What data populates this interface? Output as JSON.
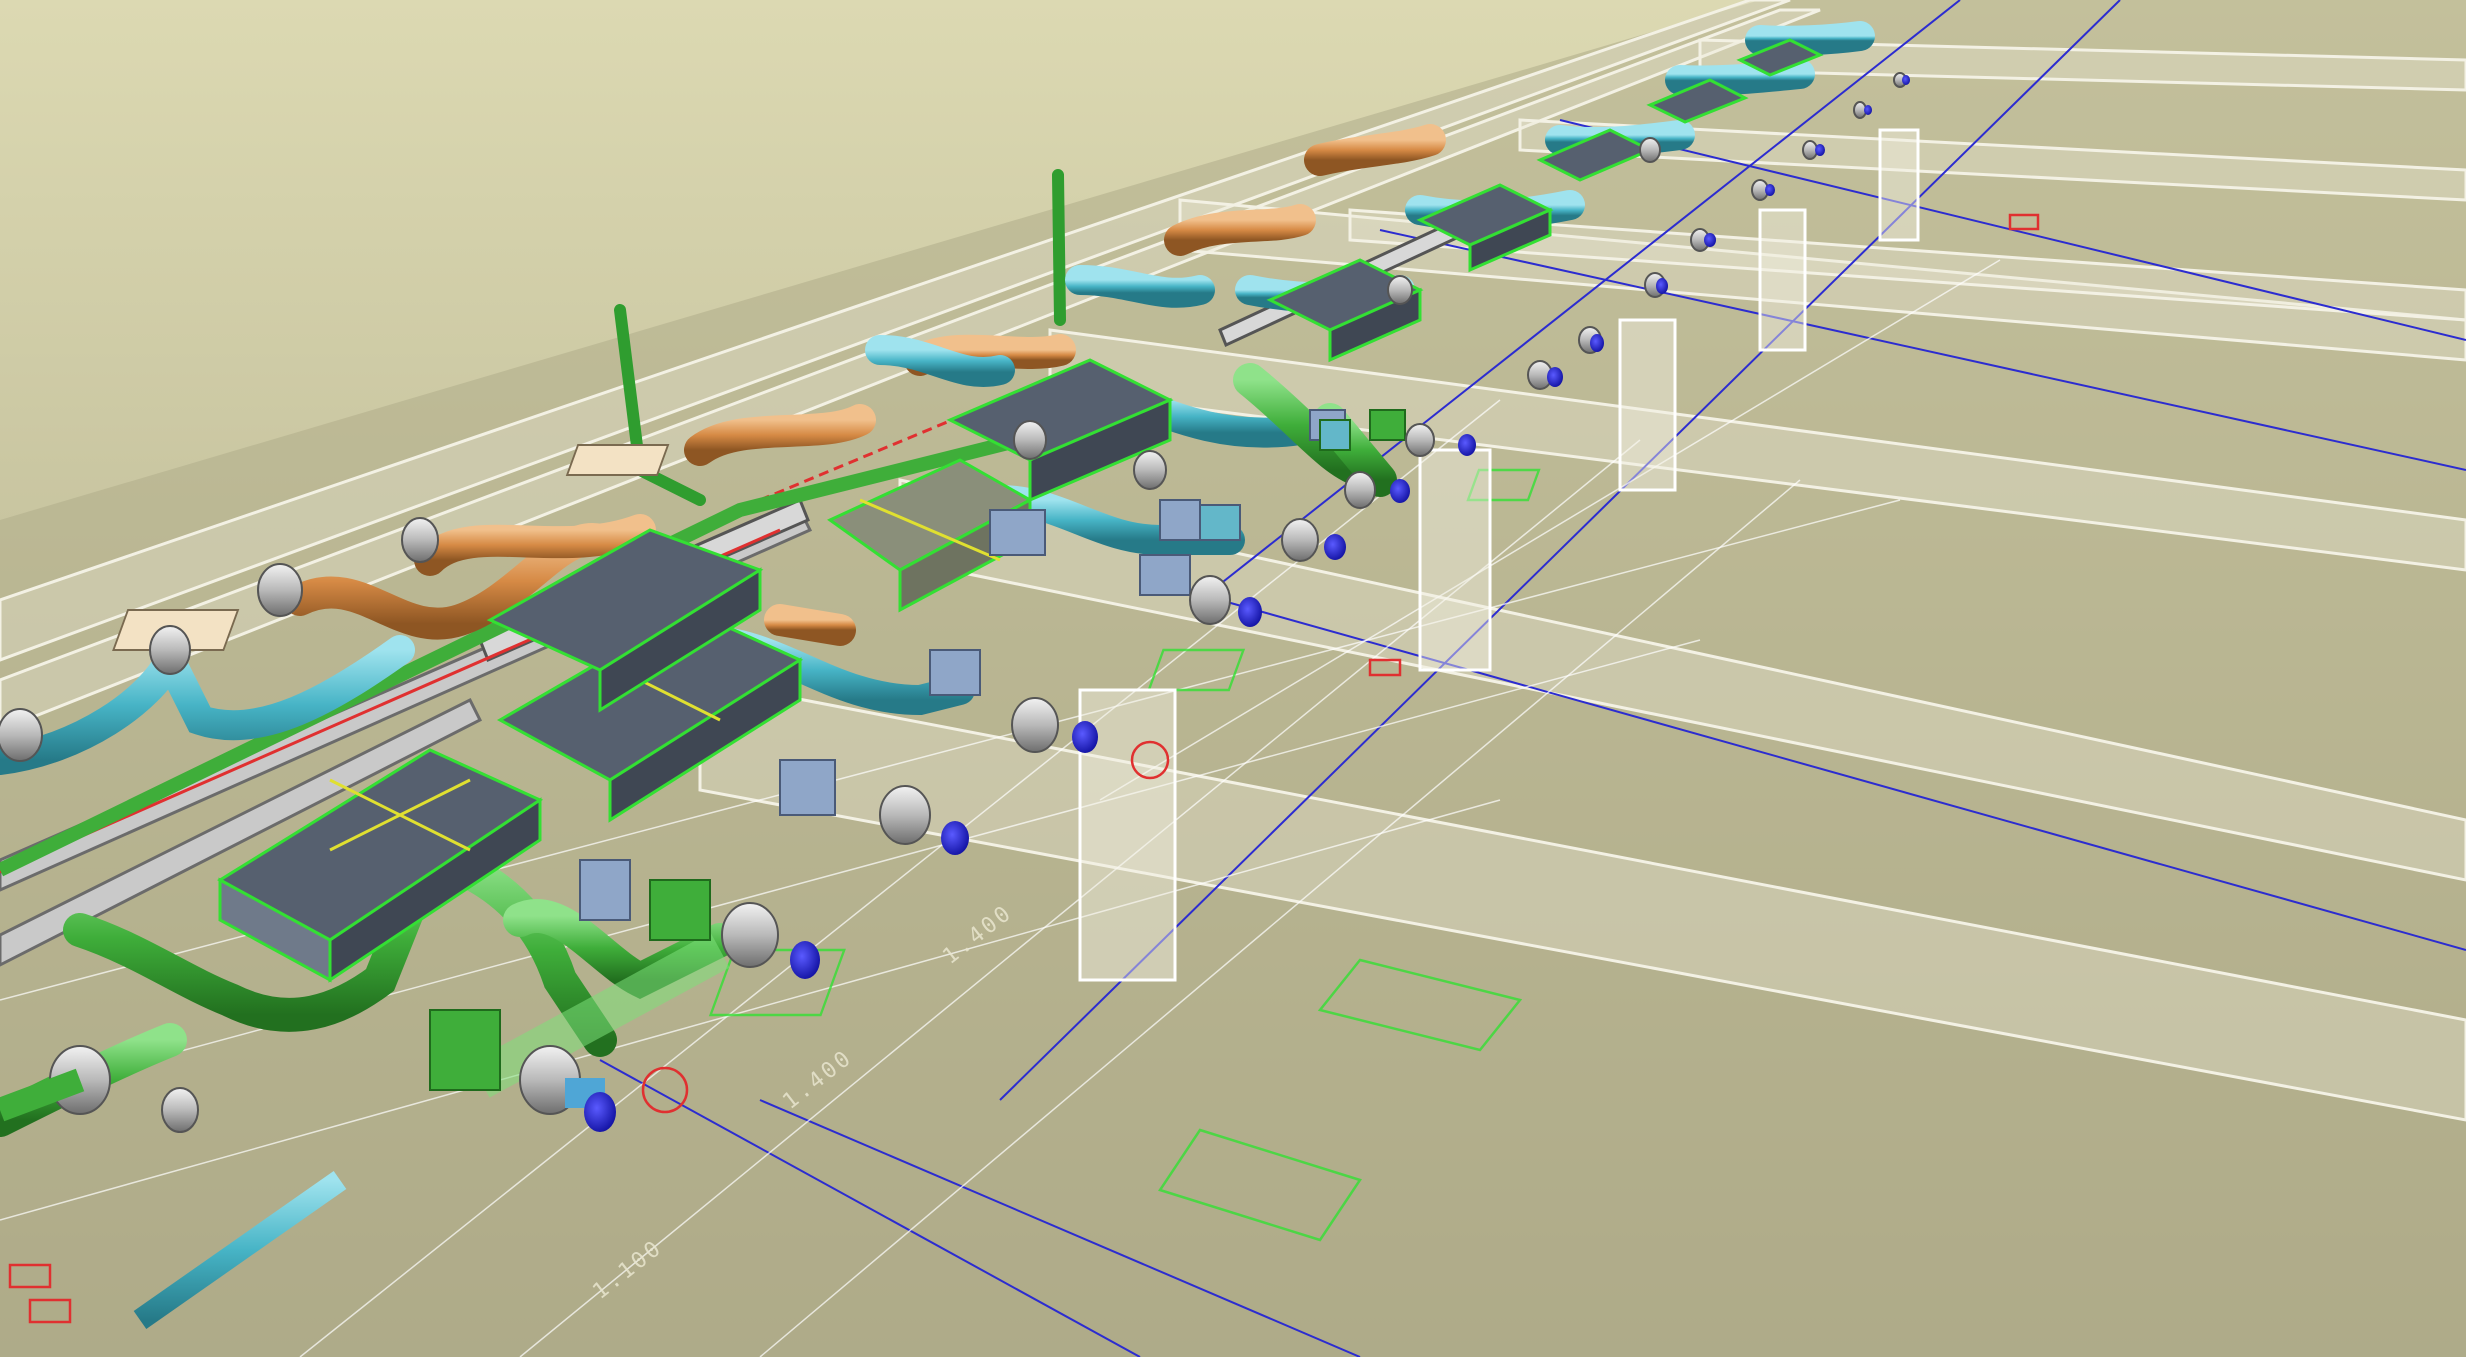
{
  "viewport": {
    "background_top": "#dcd9b2",
    "background_bottom": "#a9a584",
    "colors": {
      "supply_air_duct": "#4cb8c9",
      "return_air_duct": "#3fae3a",
      "exhaust_duct": "#d68a45",
      "fan_coil_unit": "#56606f",
      "terminal_box": "#8fa6c8",
      "diffuser_cap": "#1414c8",
      "grid_line": "#2c2cd0",
      "structure": "#e8e6d6",
      "outline_green": "#33e033",
      "outline_red": "#e03030"
    },
    "icons": [
      "fan-coil-unit-icon",
      "duct-elbow-icon",
      "diffuser-icon",
      "column-icon"
    ]
  },
  "dimensions": {
    "label_1": "1.400",
    "label_2": "1.400",
    "label_3": "1.100"
  }
}
